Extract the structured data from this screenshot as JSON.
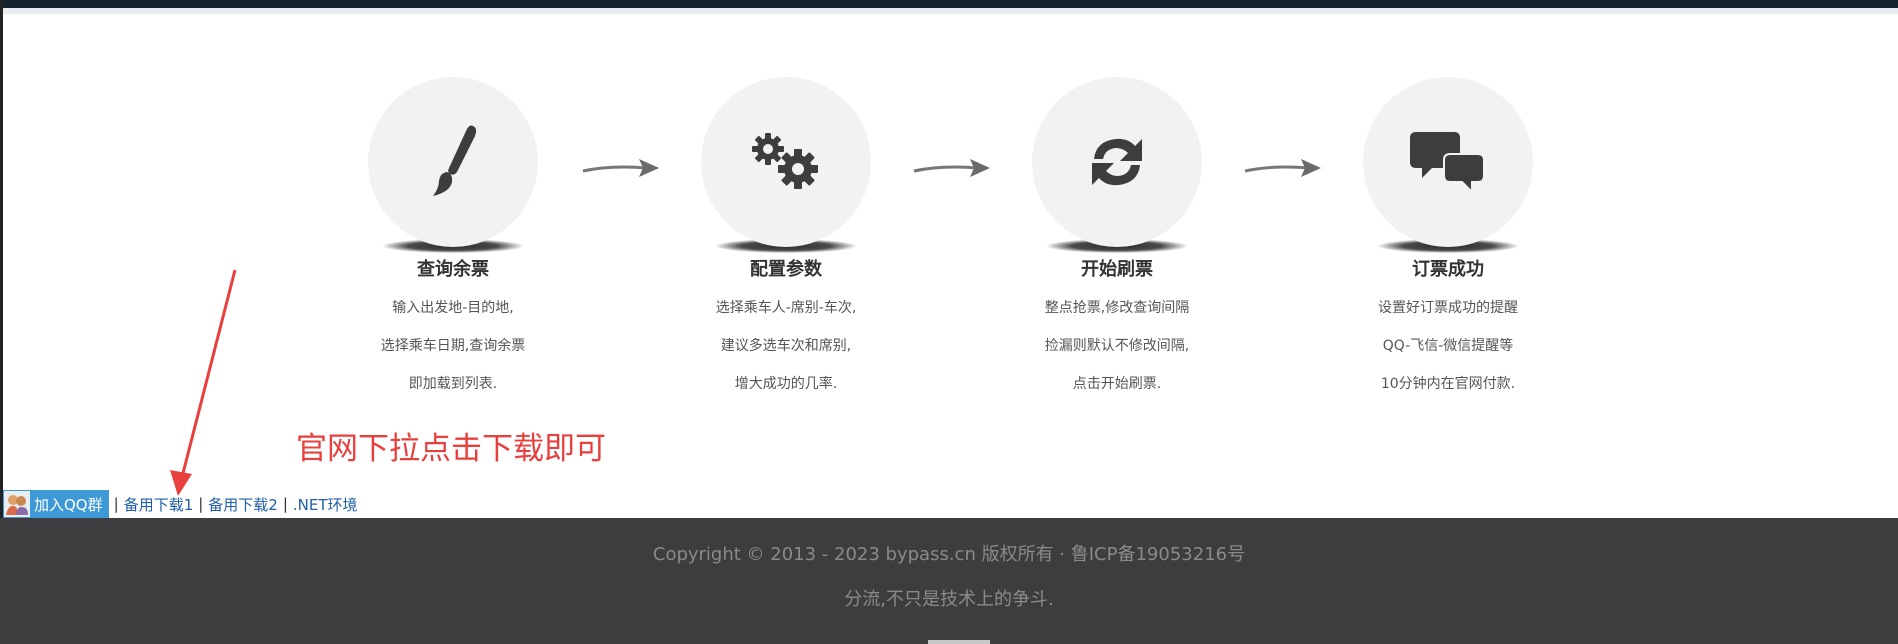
{
  "steps": [
    {
      "title": "查询余票",
      "lines": [
        "输入出发地-目的地,",
        "选择乘车日期,查询余票",
        "即加载到列表."
      ],
      "icon": "paintbrush-icon"
    },
    {
      "title": "配置参数",
      "lines": [
        "选择乘车人-席别-车次,",
        "建议多选车次和席别,",
        "增大成功的几率."
      ],
      "icon": "gears-icon"
    },
    {
      "title": "开始刷票",
      "lines": [
        "整点抢票,修改查询间隔",
        "捡漏则默认不修改间隔,",
        "点击开始刷票."
      ],
      "icon": "refresh-icon"
    },
    {
      "title": "订票成功",
      "lines": [
        "设置好订票成功的提醒",
        "QQ-飞信-微信提醒等",
        "10分钟内在官网付款."
      ],
      "icon": "chat-bubbles-icon"
    }
  ],
  "annotation": "官网下拉点击下载即可",
  "links": {
    "qq_group": "加入QQ群",
    "sep": "|",
    "backup1": "备用下载1",
    "backup2": "备用下载2",
    "dotnet": ".NET环境"
  },
  "footer": {
    "copyright": "Copyright © 2013 - 2023 bypass.cn 版权所有 · 鲁ICP备19053216号",
    "slogan": "分流,不只是技术上的争斗."
  },
  "colors": {
    "accent_red": "#e8403f",
    "link_blue": "#1f5fa8",
    "footer_bg": "#3d3d3f",
    "qq_blue": "#3d9ad6"
  }
}
